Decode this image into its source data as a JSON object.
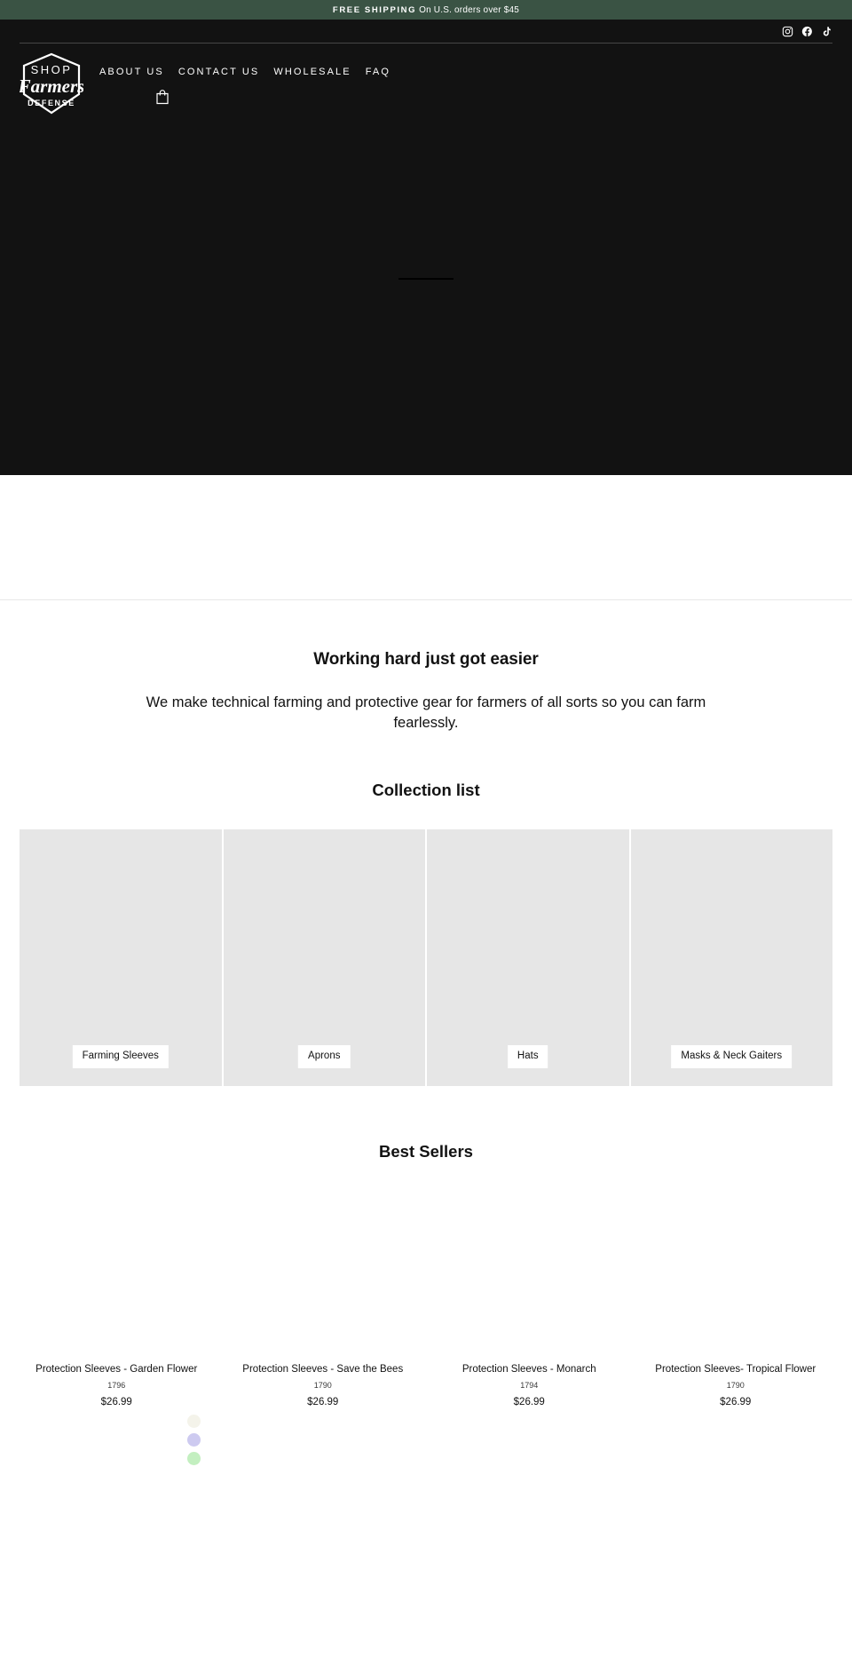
{
  "announcement": {
    "strong": "FREE SHIPPING",
    "rest": " On U.S. orders over $45",
    "background": "#3a5344"
  },
  "header": {
    "background": "#121212",
    "logo_top": "SHOP",
    "logo_main": "Farmers",
    "logo_bottom": "DEFENSE",
    "social": [
      {
        "name": "instagram-icon",
        "label": "Instagram"
      },
      {
        "name": "facebook-icon",
        "label": "Facebook"
      },
      {
        "name": "tiktok-icon",
        "label": "TikTok"
      }
    ],
    "nav": [
      {
        "label": "ABOUT US"
      },
      {
        "label": "CONTACT US"
      },
      {
        "label": "WHOLESALE"
      },
      {
        "label": "FAQ"
      }
    ],
    "cart_label": "Cart"
  },
  "hero": {
    "background": "#121212"
  },
  "intro": {
    "heading": "Working hard just got easier",
    "body": "We make technical farming and protective gear for farmers of all sorts so you can farm fearlessly."
  },
  "collections": {
    "title": "Collection list",
    "items": [
      {
        "label": "Farming Sleeves"
      },
      {
        "label": "Aprons"
      },
      {
        "label": "Hats"
      },
      {
        "label": "Masks & Neck Gaiters"
      }
    ]
  },
  "bestsellers": {
    "title": "Best Sellers",
    "products": [
      {
        "title": "Protection Sleeves - Garden Flower",
        "sku": "1796",
        "price": "$26.99"
      },
      {
        "title": "Protection Sleeves - Save the Bees",
        "sku": "1790",
        "price": "$26.99"
      },
      {
        "title": "Protection Sleeves - Monarch",
        "sku": "1794",
        "price": "$26.99"
      },
      {
        "title": "Protection Sleeves- Tropical Flower",
        "sku": "1790",
        "price": "$26.99"
      }
    ]
  },
  "swatches": [
    {
      "name": "swatch-cream",
      "color": "#f4f3ea"
    },
    {
      "name": "swatch-lavender",
      "color": "#cdcaf0"
    },
    {
      "name": "swatch-mint",
      "color": "#c3efc0"
    }
  ]
}
